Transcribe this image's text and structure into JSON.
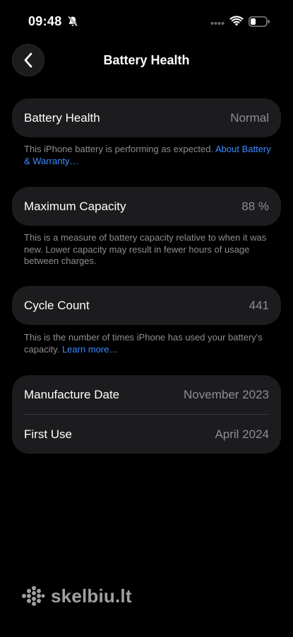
{
  "status_bar": {
    "time": "09:48",
    "icons": [
      "bell-slash-icon",
      "cellular-dots-icon",
      "wifi-icon",
      "battery-icon"
    ]
  },
  "nav": {
    "title": "Battery Health",
    "back_icon": "chevron-left-icon"
  },
  "battery_health": {
    "label": "Battery Health",
    "value": "Normal",
    "footnote_text": "This iPhone battery is performing as expected. ",
    "footnote_link": "About Battery & Warranty…"
  },
  "maximum_capacity": {
    "label": "Maximum Capacity",
    "value": "88 %",
    "footnote_text": "This is a measure of battery capacity relative to when it was new. Lower capacity may result in fewer hours of usage between charges."
  },
  "cycle_count": {
    "label": "Cycle Count",
    "value": "441",
    "footnote_text": "This is the number of times iPhone has used your battery's capacity. ",
    "footnote_link": "Learn more…"
  },
  "dates": {
    "manufacture_label": "Manufacture Date",
    "manufacture_value": "November 2023",
    "first_use_label": "First Use",
    "first_use_value": "April 2024"
  },
  "watermark": {
    "text": "skelbiu.lt"
  },
  "colors": {
    "background": "#000000",
    "card": "#1c1c1e",
    "secondary_text": "#8e8e93",
    "link": "#3a8cff"
  }
}
